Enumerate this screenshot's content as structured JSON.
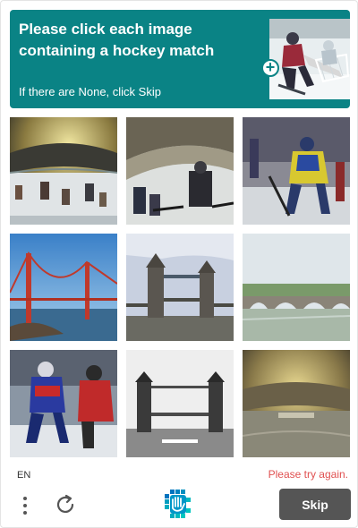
{
  "prompt": {
    "title": "Please click each image containing a hockey match",
    "subtitle": "If there are None, click Skip",
    "example_image": "hockey-goalie-example",
    "accent_color": "#0a8385"
  },
  "grid": {
    "tiles": [
      {
        "subject": "hockey-arena-players"
      },
      {
        "subject": "hockey-players-stick-closeup"
      },
      {
        "subject": "hockey-player-yellow-jersey"
      },
      {
        "subject": "golden-gate-bridge"
      },
      {
        "subject": "tower-bridge"
      },
      {
        "subject": "stone-arch-bridge"
      },
      {
        "subject": "hockey-players-blue-red"
      },
      {
        "subject": "tower-bridge-bw"
      },
      {
        "subject": "arena-interior"
      }
    ]
  },
  "footer": {
    "language": "EN",
    "error_text": "Please try again.",
    "error_color": "#e05050",
    "skip_label": "Skip",
    "menu_icon": "more-vertical-icon",
    "refresh_icon": "refresh-icon",
    "logo_icon": "hcaptcha-logo-icon"
  }
}
